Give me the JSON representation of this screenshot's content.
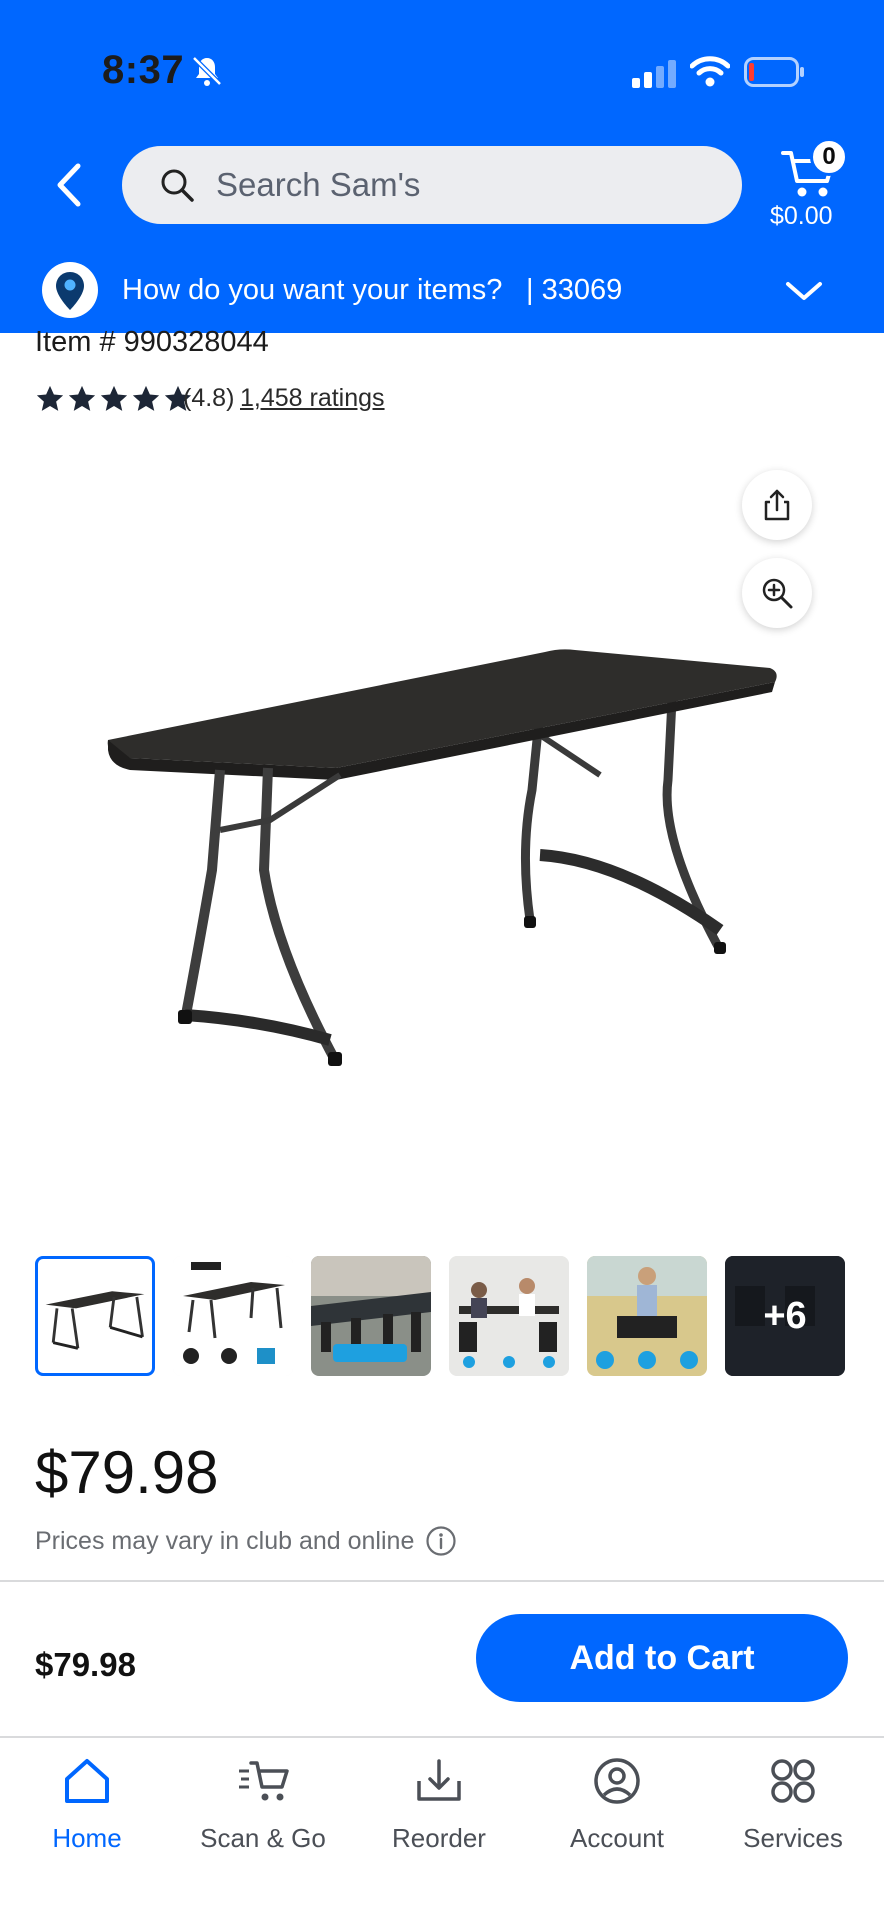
{
  "status_bar": {
    "time": "8:37"
  },
  "header": {
    "search_placeholder": "Search Sam's",
    "cart_count": "0",
    "cart_total": "$0.00",
    "delivery_prompt": "How do you want your items?",
    "delivery_zip": "| 33069"
  },
  "product": {
    "item_number": "Item # 990328044",
    "rating_value": "(4.8)",
    "rating_count": "1,458 ratings",
    "stars": 5,
    "thumbnails_more": "+6",
    "price": "$79.98",
    "price_note": "Prices may vary in club and online"
  },
  "bottom_bar": {
    "price": "$79.98",
    "add_to_cart": "Add to Cart"
  },
  "tabs": [
    {
      "label": "Home",
      "icon": "home-icon",
      "active": true
    },
    {
      "label": "Scan & Go",
      "icon": "scan-cart-icon",
      "active": false
    },
    {
      "label": "Reorder",
      "icon": "reorder-icon",
      "active": false
    },
    {
      "label": "Account",
      "icon": "account-icon",
      "active": false
    },
    {
      "label": "Services",
      "icon": "services-icon",
      "active": false
    }
  ],
  "colors": {
    "brand_blue": "#0067ff"
  }
}
